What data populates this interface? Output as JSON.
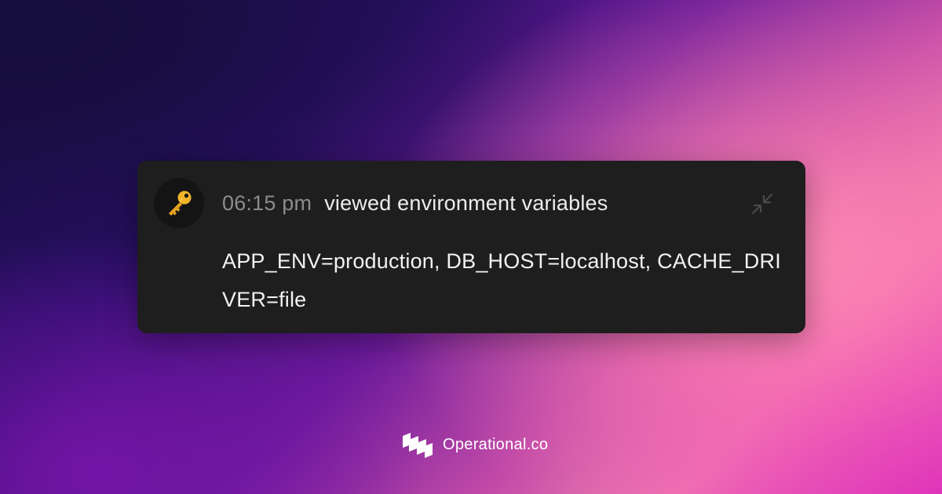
{
  "card": {
    "avatar_icon": "key-icon",
    "time": "06:15 pm",
    "action": "viewed environment variables",
    "details": "APP_ENV=production, DB_HOST=localhost, CACHE_DRIVER=file",
    "collapse_icon": "collapse-arrows-icon"
  },
  "footer": {
    "logo_icon": "operational-logo-icon",
    "brand_name": "Operational.co"
  },
  "colors": {
    "card_background": "#1e1e1f",
    "avatar_background": "#141415",
    "time_text": "#8c8c8f",
    "primary_text": "#ececec",
    "key_gold": "#f0b429"
  }
}
